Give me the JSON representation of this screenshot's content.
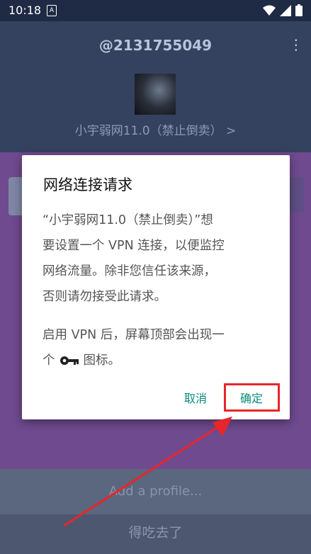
{
  "status_bar": {
    "time": "10:18",
    "notification_glyph": "A"
  },
  "header": {
    "username": "@2131755049",
    "profile_name": "小宇弱网11.0（禁止倒卖） >"
  },
  "dialog": {
    "title": "网络连接请求",
    "body_line1": "“小宇弱网11.0（禁止倒卖）”想",
    "body_line2": "要设置一个 VPN 连接，以便监控",
    "body_line3": "网络流量。除非您信任该来源，",
    "body_line4": "否则请勿接受此请求。",
    "body2_line1": "启用 VPN 后，屏幕顶部会出现一",
    "body2_line2_pre": "个",
    "body2_line2_post": "图标。",
    "cancel_label": "取消",
    "ok_label": "确定"
  },
  "bottom": {
    "add_profile_label": "Add a profile...",
    "action_label": "得吃去了"
  },
  "colors": {
    "highlight": "#e8262a",
    "accent": "#0a8a7a"
  }
}
